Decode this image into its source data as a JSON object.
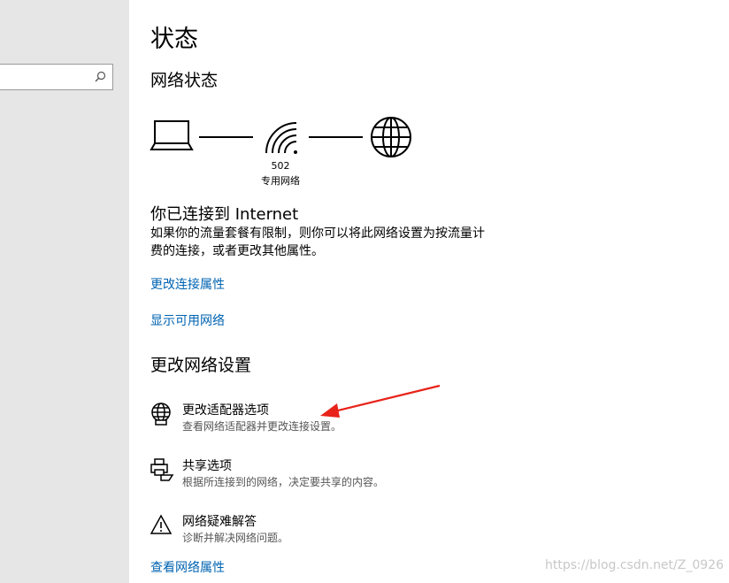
{
  "sidebar": {
    "search": {
      "placeholder": "",
      "icon": "search-icon"
    }
  },
  "page": {
    "title": "状态",
    "network_status_heading": "网络状态"
  },
  "diagram": {
    "network_name": "502",
    "network_type": "专用网络",
    "icons": [
      "laptop-icon",
      "wifi-icon",
      "globe-icon"
    ]
  },
  "connection": {
    "heading": "你已连接到 Internet",
    "desc_line1": "如果你的流量套餐有限制，则你可以将此网络设置为按流量计",
    "desc_line2": "费的连接，或者更改其他属性。",
    "link_change_props": "更改连接属性",
    "link_show_networks": "显示可用网络"
  },
  "settings": {
    "heading": "更改网络设置",
    "options": [
      {
        "title": "更改适配器选项",
        "desc": "查看网络适配器并更改连接设置。",
        "icon": "adapter-globe-icon"
      },
      {
        "title": "共享选项",
        "desc": "根据所连接到的网络，决定要共享的内容。",
        "icon": "sharing-printer-icon"
      },
      {
        "title": "网络疑难解答",
        "desc": "诊断并解决网络问题。",
        "icon": "warning-icon"
      }
    ],
    "link_view_props": "查看网络属性"
  },
  "watermark": "https://blog.csdn.net/Z_0926",
  "colors": {
    "link": "#0063b1",
    "sidebar_bg": "#e6e6e6",
    "arrow": "#e8231a"
  }
}
